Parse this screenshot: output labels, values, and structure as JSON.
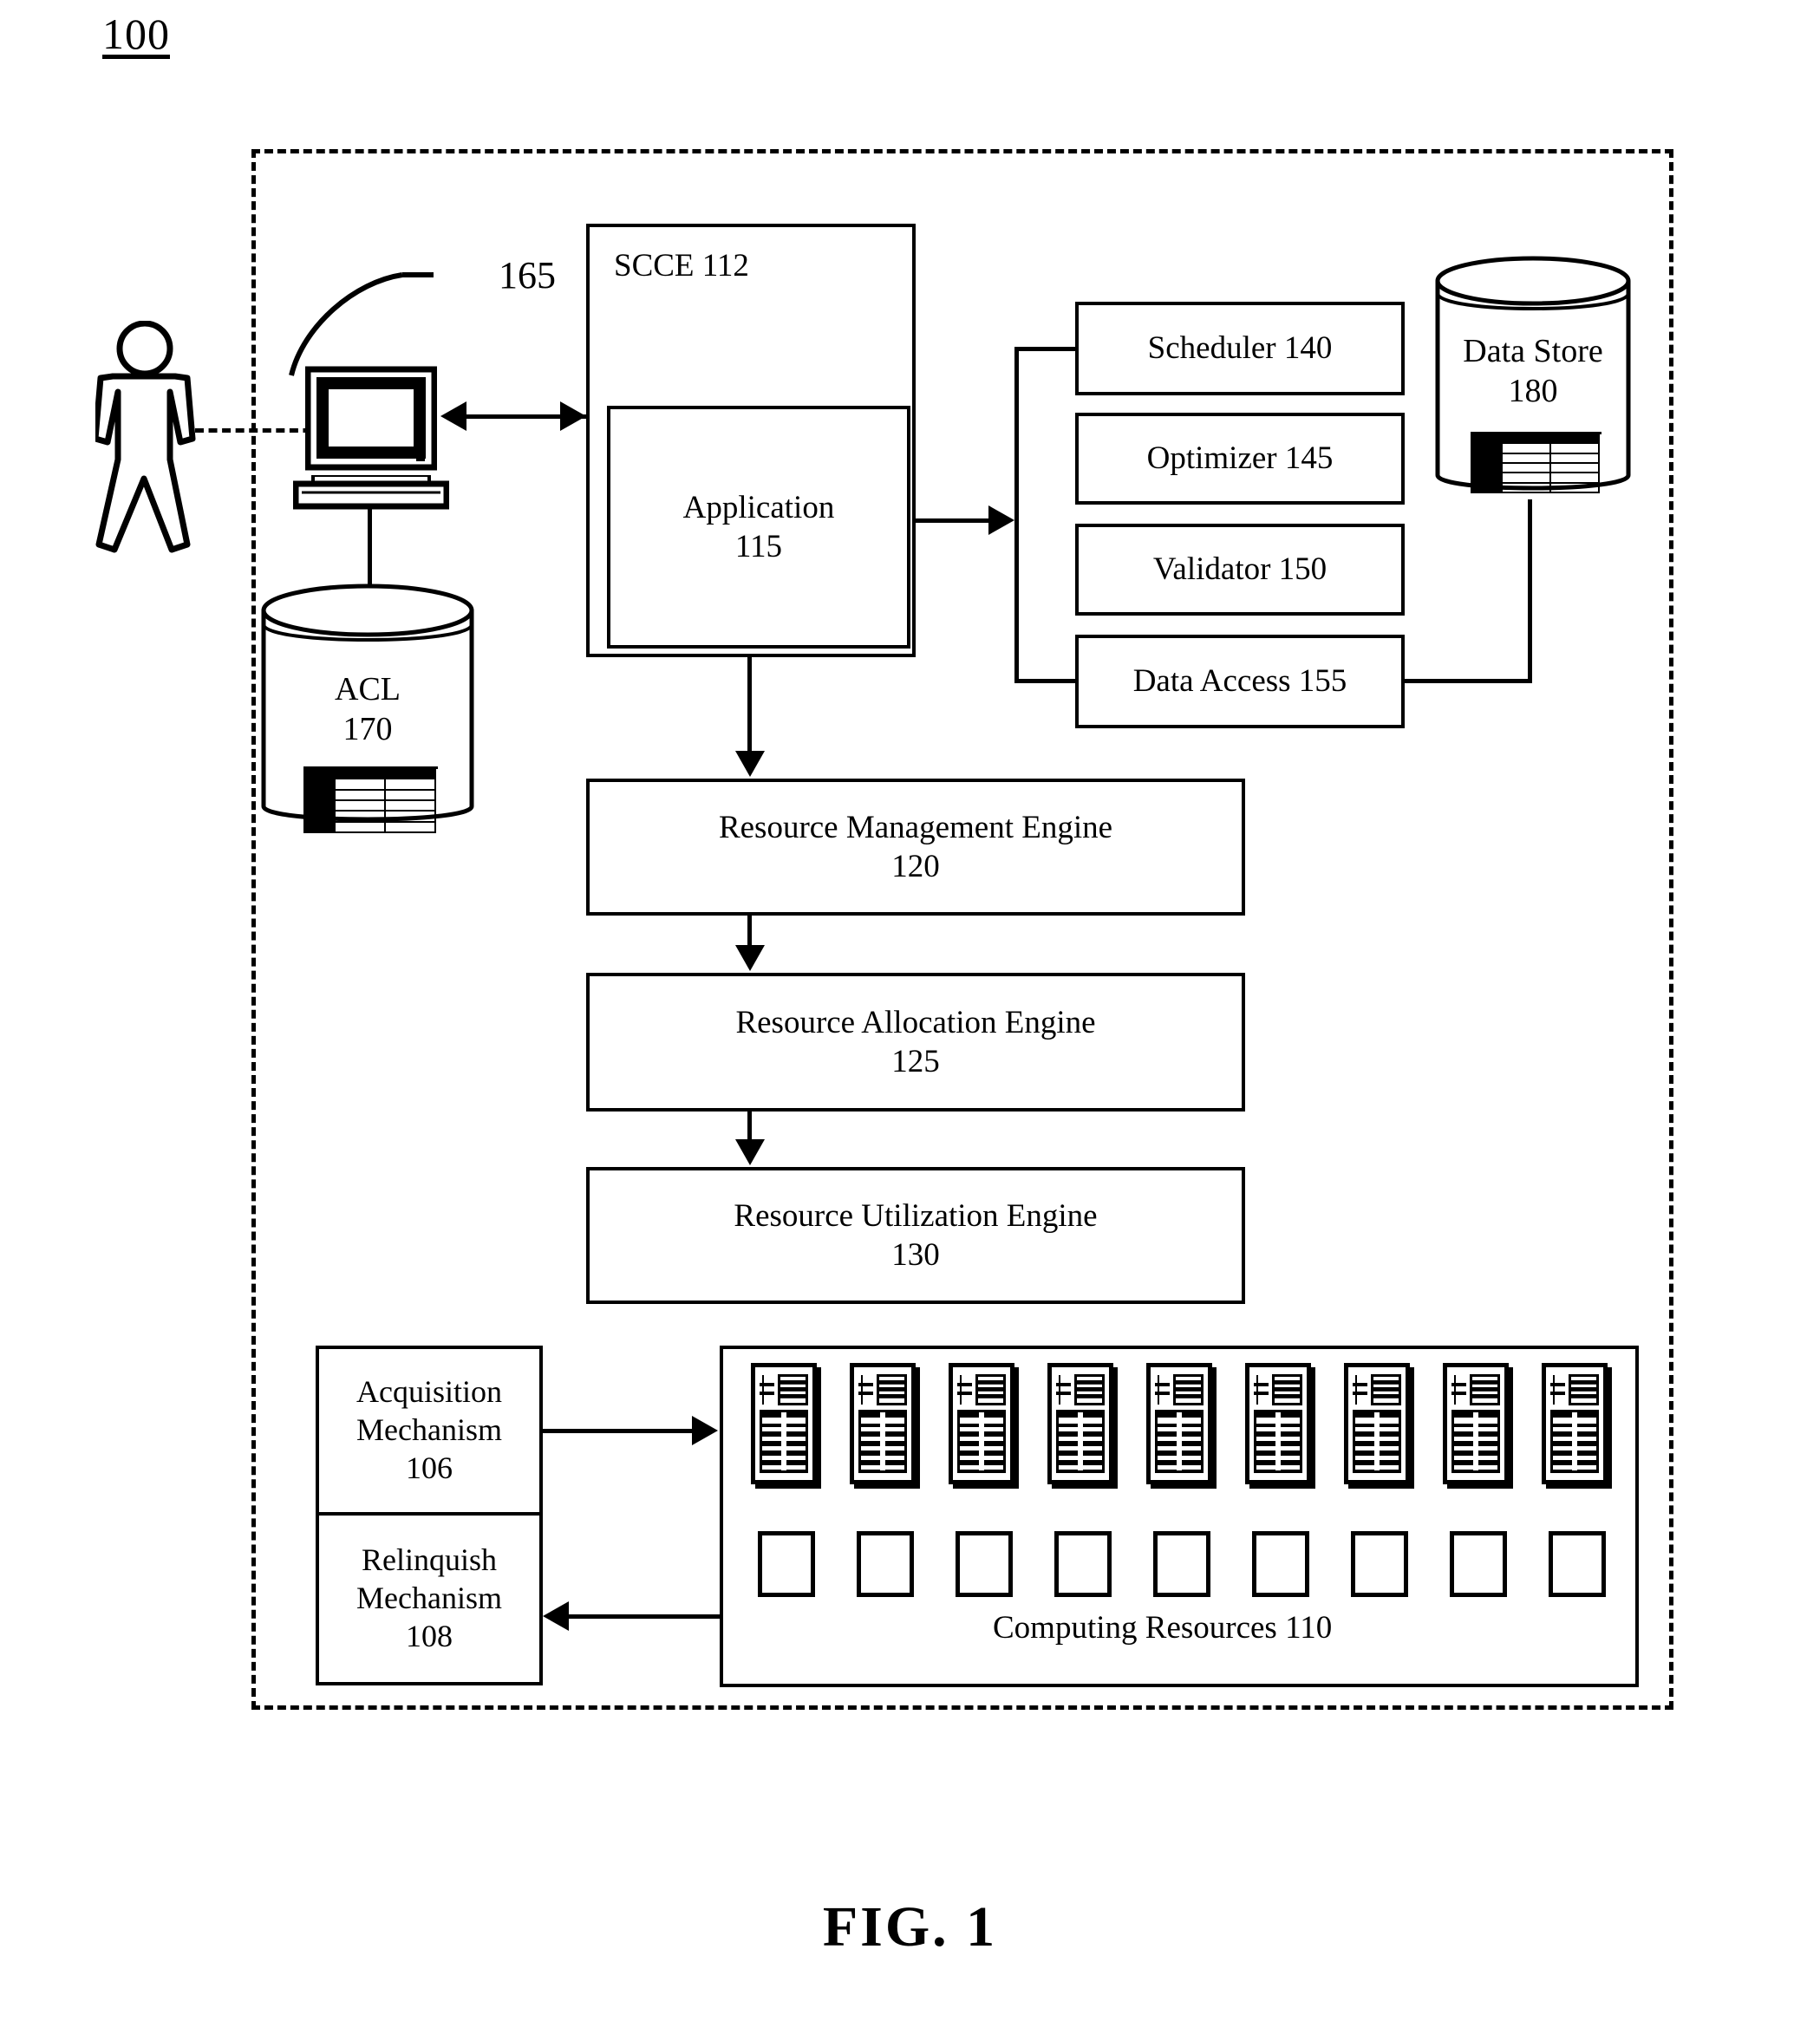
{
  "figure": {
    "number": "100",
    "caption": "FIG. 1"
  },
  "boundary": {
    "name": "system-boundary"
  },
  "actors": {
    "user_icon": "person-icon",
    "workstation_icon": "computer-monitor-icon",
    "workstation_ref": "165"
  },
  "scce": {
    "title": "SCCE 112",
    "application": {
      "line1": "Application",
      "line2": "115"
    }
  },
  "services": [
    {
      "label": "Scheduler 140"
    },
    {
      "label": "Optimizer 145"
    },
    {
      "label": "Validator 150"
    },
    {
      "label": "Data Access 155"
    }
  ],
  "data_store": {
    "line1": "Data Store",
    "line2": "180",
    "icon": "database-cylinder-icon"
  },
  "acl": {
    "line1": "ACL",
    "line2": "170",
    "icon": "database-cylinder-icon"
  },
  "engines": [
    {
      "line1": "Resource Management Engine",
      "line2": "120"
    },
    {
      "line1": "Resource Allocation Engine",
      "line2": "125"
    },
    {
      "line1": "Resource Utilization Engine",
      "line2": "130"
    }
  ],
  "mechanisms": [
    {
      "line1": "Acquisition",
      "line2": "Mechanism",
      "line3": "106"
    },
    {
      "line1": "Relinquish",
      "line2": "Mechanism",
      "line3": "108"
    }
  ],
  "computing_resources": {
    "label": "Computing Resources 110",
    "rack_count": 9,
    "slot_count": 9,
    "rack_icon": "server-rack-icon",
    "slot_icon": "empty-slot-icon"
  },
  "colors": {
    "line": "#000000",
    "background": "#ffffff"
  }
}
